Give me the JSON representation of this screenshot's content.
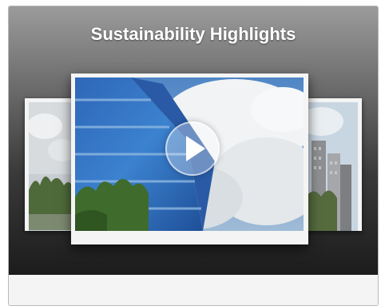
{
  "widget": {
    "title": "Sustainability Highlights"
  },
  "carousel": {
    "slides": [
      {
        "position": "left",
        "icon": "trees-photo"
      },
      {
        "position": "center",
        "icon": "glass-building-photo",
        "overlay_icon": "play-icon"
      },
      {
        "position": "right",
        "icon": "city-towers-photo"
      }
    ]
  },
  "colors": {
    "stage_top": "#9b9b9b",
    "stage_bottom": "#1c1c1c",
    "frame": "#f4f4f4",
    "title": "#ffffff"
  }
}
